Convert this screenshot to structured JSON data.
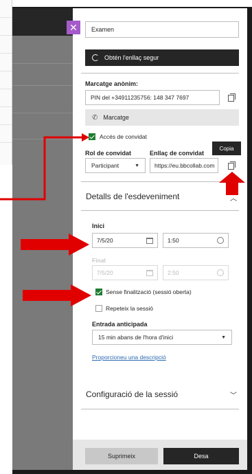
{
  "panel": {
    "close_icon": "close-icon",
    "title_value": "Examen",
    "secure_link_label": "Obtén l'enllaç segur",
    "anonymous_dialin_label": "Marcatge anònim:",
    "pin_value": "PIN del +34911235756: 148 347 7697",
    "dial_button_label": "Marcatge",
    "guest_access_label": "Accés de convidat",
    "guest_access_checked": true,
    "guest_role_label": "Rol de convidat",
    "guest_role_value": "Participant",
    "guest_link_label": "Enllaç de convidat",
    "guest_link_value": "https://eu.bbcollab.com",
    "copy_tooltip": "Copia"
  },
  "event_details": {
    "section_title": "Detalls de l'esdeveniment",
    "start_label": "Inici",
    "start_date": "7/5/20",
    "start_time": "1:50",
    "end_label": "Final",
    "end_date": "7/5/20",
    "end_time": "2:50",
    "no_end_label": "Sense finalització (sessió oberta)",
    "no_end_checked": true,
    "repeat_label": "Repeteix la sessió",
    "repeat_checked": false,
    "early_entry_label": "Entrada anticipada",
    "early_entry_value": "15 min abans de l'hora d'inici",
    "description_link": "Proporcioneu una descripció"
  },
  "session_settings": {
    "section_title": "Configuració de la sessió"
  },
  "footer": {
    "delete_label": "Suprimeix",
    "save_label": "Desa"
  },
  "colors": {
    "close_button": "#a55bc9",
    "checkbox_on": "#1e7d32",
    "annotation_arrow": "#e00000",
    "link": "#2e6ab1"
  }
}
